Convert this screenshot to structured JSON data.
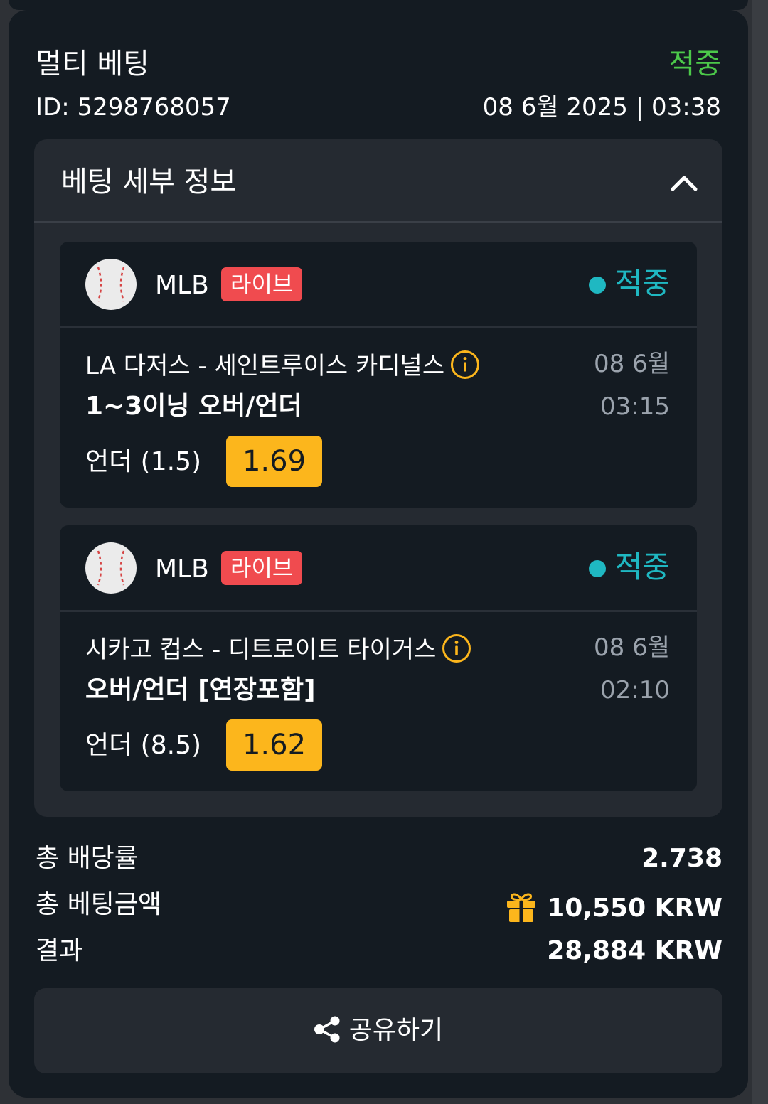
{
  "card": {
    "title": "멀티 베팅",
    "status": "적중",
    "bet_id": "ID: 5298768057",
    "datetime": "08 6월 2025 | 03:38"
  },
  "details": {
    "title": "베팅 세부 정보",
    "selections": [
      {
        "league": "MLB",
        "badge": "라이브",
        "status": "적중",
        "match": "LA 다저스 - 세인트루이스 카디널스",
        "market": "1~3이닝 오버/언더",
        "date": "08 6월",
        "time": "03:15",
        "pick": "언더 (1.5)",
        "odds": "1.69"
      },
      {
        "league": "MLB",
        "badge": "라이브",
        "status": "적중",
        "match": "시카고 컵스 - 디트로이트 타이거스",
        "market": "오버/언더 [연장포함]",
        "date": "08 6월",
        "time": "02:10",
        "pick": "언더 (8.5)",
        "odds": "1.62"
      }
    ]
  },
  "summary": {
    "total_odds_label": "총 배당률",
    "total_odds_value": "2.738",
    "total_stake_label": "총 베팅금액",
    "total_stake_value": "10,550 KRW",
    "result_label": "결과",
    "result_value": "28,884 KRW"
  },
  "share_label": "공유하기",
  "icons": {
    "collapse": "chevron-up-icon",
    "sport": "baseball-icon",
    "info": "info-icon",
    "bonus": "gift-icon",
    "share": "share-icon"
  },
  "colors": {
    "won_green": "#4cc94a",
    "won_teal": "#1fb8c2",
    "live_red": "#f04b4f",
    "odds_yellow": "#fcb61c"
  }
}
